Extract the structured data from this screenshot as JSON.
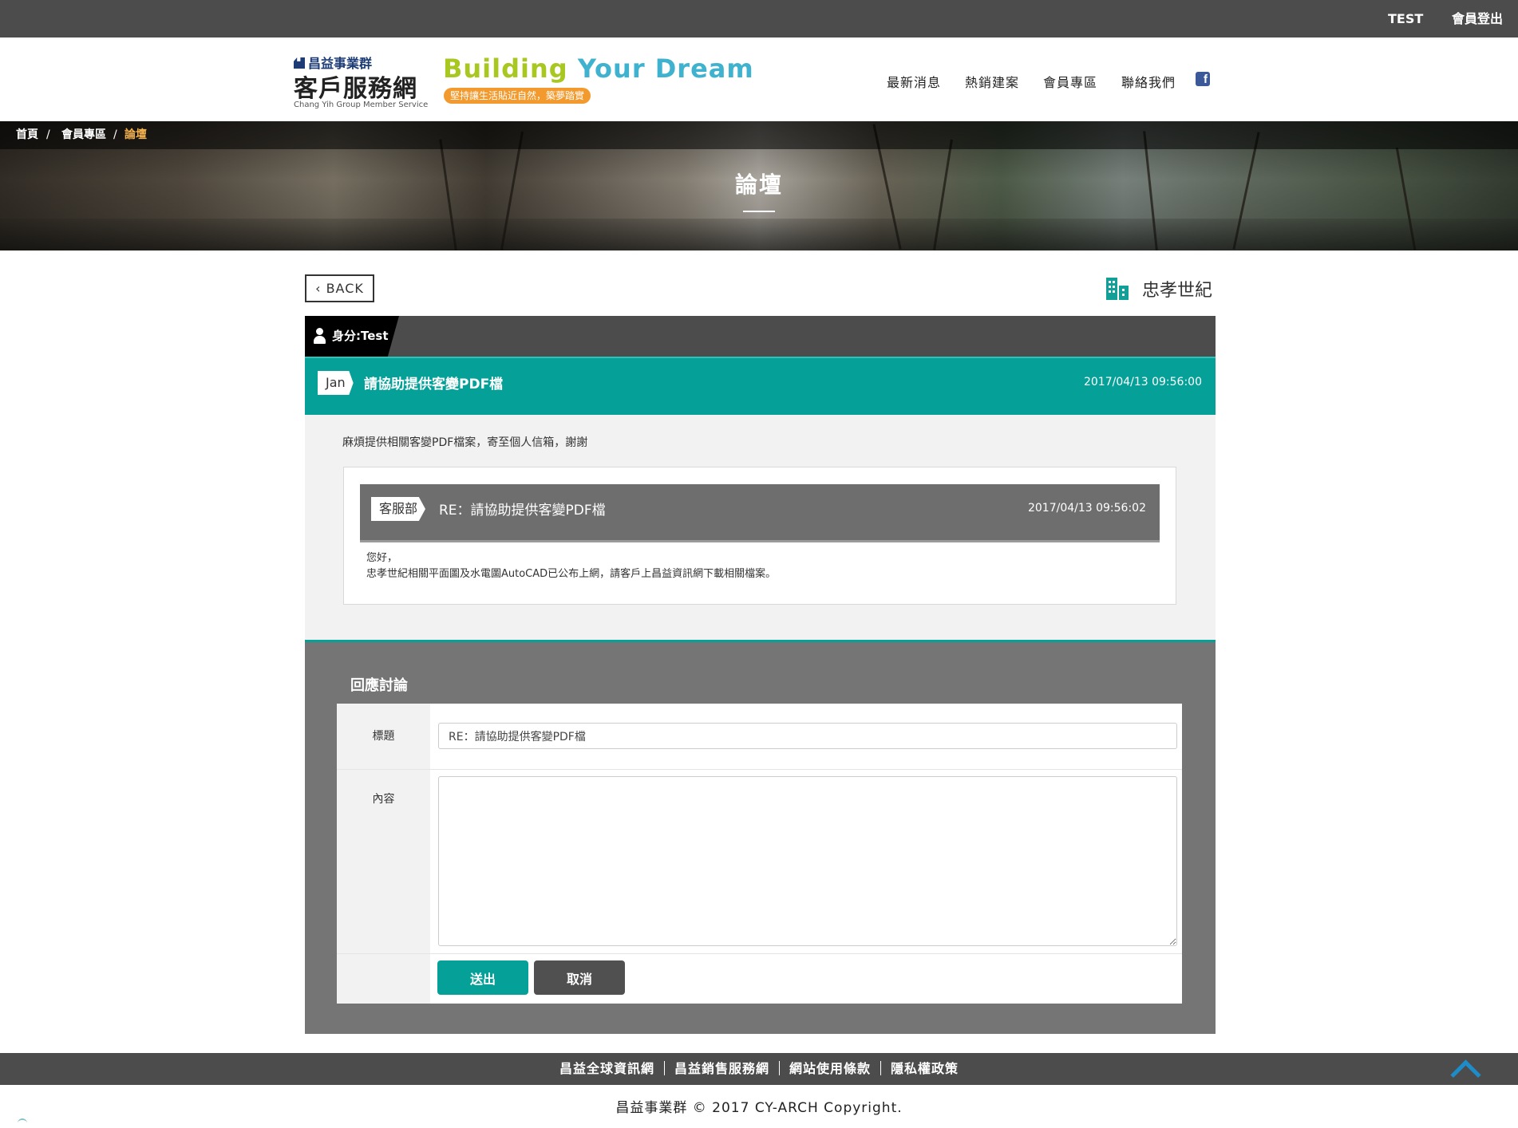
{
  "topbar": {
    "user": "TEST",
    "logout": "會員登出"
  },
  "header": {
    "group_name": "昌益事業群",
    "site_name": "客戶服務網",
    "site_sub": "Chang Yih Group Member Service",
    "slogan_word1": "Building",
    "slogan_word2": "Your Dream",
    "tagline": "堅持讓生活貼近自然，築夢踏實",
    "nav": [
      "最新消息",
      "熱銷建案",
      "會員專區",
      "聯絡我們"
    ],
    "facebook_icon": "facebook-icon"
  },
  "breadcrumb": {
    "home": "首頁",
    "member": "會員專區",
    "current": "論壇",
    "separator": "/"
  },
  "banner": {
    "title": "論壇"
  },
  "toolbar": {
    "back_label": "‹ BACK",
    "project_name": "忠孝世紀",
    "project_icon": "building-icon"
  },
  "user": {
    "identity": "身分:Test"
  },
  "topic": {
    "author": "Jan",
    "title": "請協助提供客變PDF檔",
    "date": "2017/04/13 09:56:00",
    "content": "麻煩提供相關客變PDF檔案，寄至個人信箱，謝謝"
  },
  "reply": {
    "author": "客服部",
    "title": "RE：請協助提供客變PDF檔",
    "date": "2017/04/13 09:56:02",
    "line1": "您好，",
    "line2": "忠孝世紀相關平面圖及水電圖AutoCAD已公布上網，請客戶上昌益資訊網下載相關檔案。"
  },
  "form": {
    "heading": "回應討論",
    "title_label": "標題",
    "title_value": "RE：請協助提供客變PDF檔",
    "content_label": "內容",
    "content_value": "",
    "submit_label": "送出",
    "cancel_label": "取消"
  },
  "footer": {
    "links": [
      "昌益全球資訊網",
      "昌益銷售服務網",
      "網站使用條款",
      "隱私權政策"
    ],
    "copyright": "昌益事業群 © 2017 CY-ARCH Copyright."
  },
  "colors": {
    "accent": "#05a198",
    "dark_bar": "#4c4c4c",
    "panel_gray": "#757575",
    "breadcrumb_active": "#f2b04f",
    "slogan_green": "#a8c821",
    "slogan_blue": "#3fb2cf",
    "tagline_orange": "#f29a2e"
  }
}
